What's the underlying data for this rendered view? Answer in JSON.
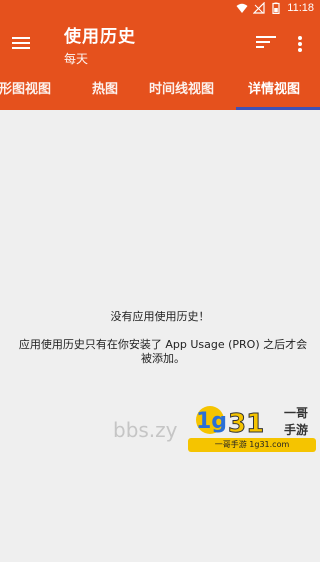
{
  "status_bar": {
    "time": "11:18",
    "icons": [
      "wifi-icon",
      "signal-icon",
      "battery-icon"
    ]
  },
  "app_bar": {
    "title": "使用历史",
    "subtitle": "每天",
    "icons": {
      "menu": "menu-icon",
      "sort": "sort-icon",
      "more": "more-vert-icon"
    }
  },
  "tabs": [
    {
      "label": "条形图视图",
      "selected": false
    },
    {
      "label": "热图",
      "selected": false
    },
    {
      "label": "时间线视图",
      "selected": false
    },
    {
      "label": "详情视图",
      "selected": true
    }
  ],
  "empty_state": {
    "title": "没有应用使用历史！",
    "description": "应用使用历史只有在你安装了 App Usage (PRO) 之后才会被添加。"
  },
  "watermark": {
    "site_text": "bbs.zy",
    "logo_text": "1g31",
    "brand": "一哥手游",
    "sub_text": "一哥手游 1g31.com"
  },
  "colors": {
    "primary": "#e5511d",
    "indicator": "#3f51b5",
    "background": "#efefef"
  }
}
